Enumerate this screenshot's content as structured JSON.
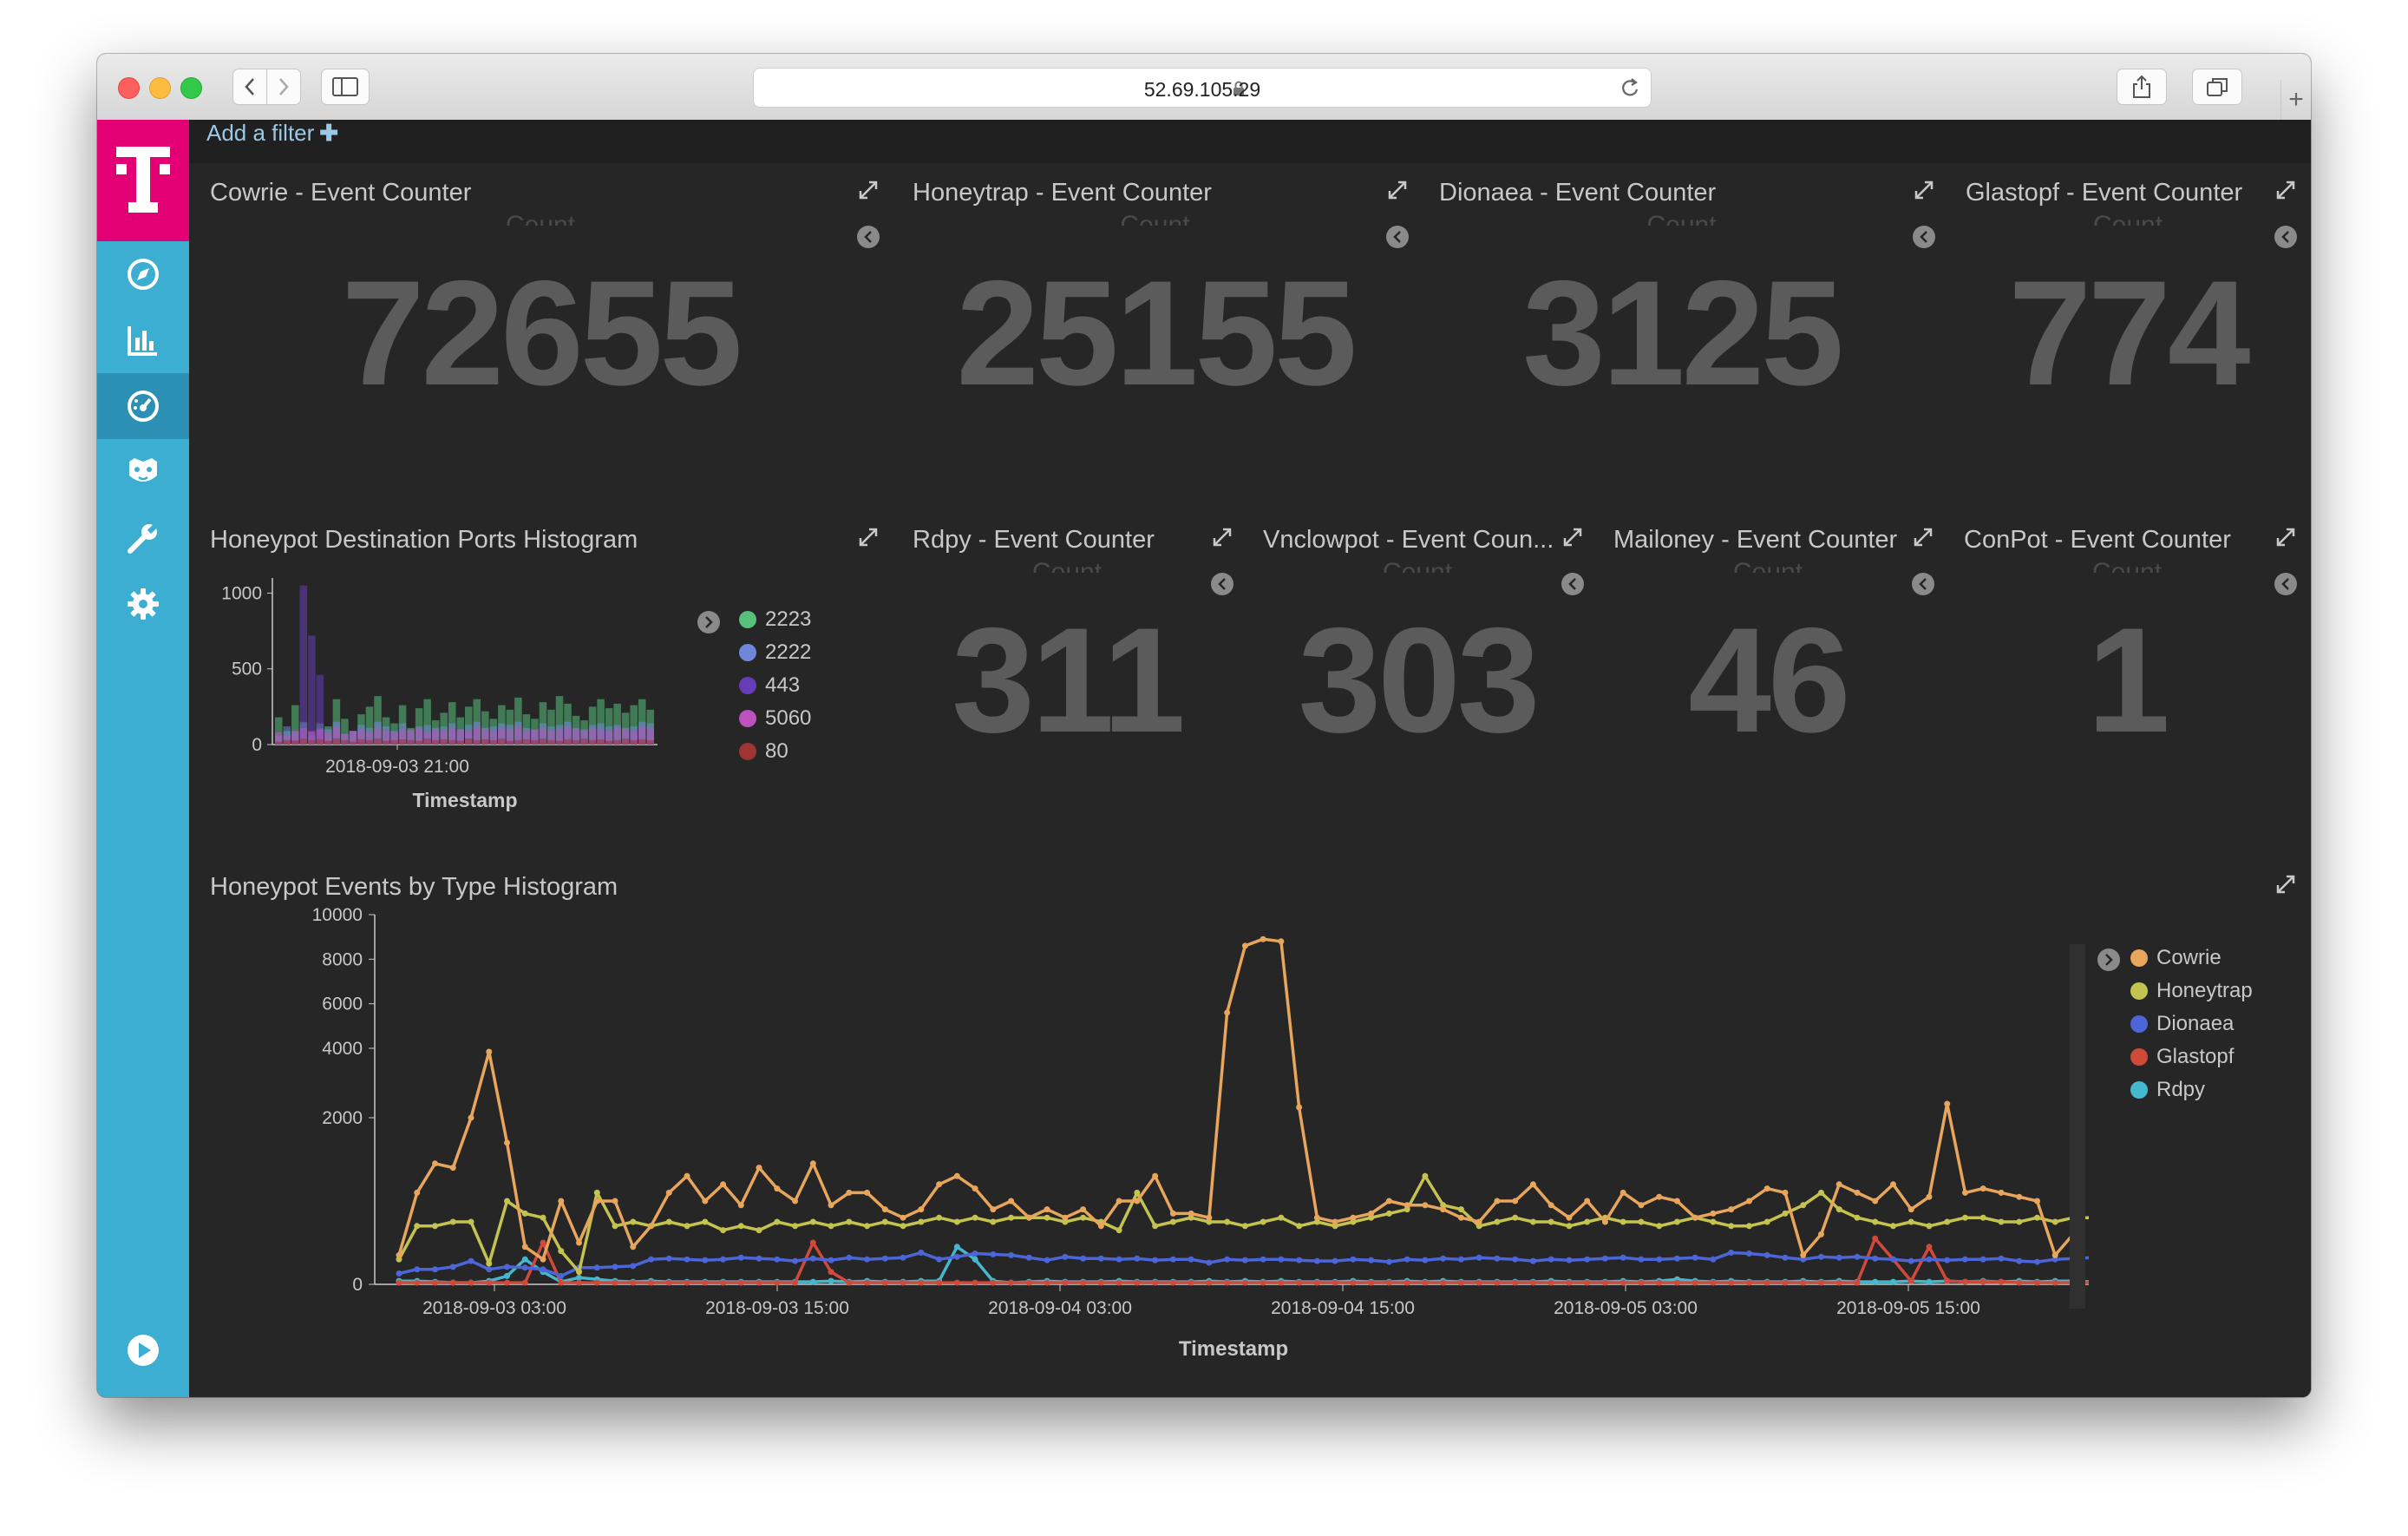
{
  "browser": {
    "url": "52.69.105.29",
    "colors": {
      "close": "#fc605c",
      "minimize": "#fdbc40",
      "zoom": "#34c84a"
    }
  },
  "kibana": {
    "brand_color": "#e20074",
    "sidebar_color": "#3caed2",
    "filter_label": "Add a filter",
    "filter_plus": "✚"
  },
  "counters": [
    {
      "title": "Cowrie - Event Counter",
      "label": "Count",
      "value": "72655"
    },
    {
      "title": "Honeytrap - Event Counter",
      "label": "Count",
      "value": "25155"
    },
    {
      "title": "Dionaea - Event Counter",
      "label": "Count",
      "value": "3125"
    },
    {
      "title": "Glastopf - Event Counter",
      "label": "Count",
      "value": "774"
    },
    {
      "title": "Rdpy - Event Counter",
      "label": "Count",
      "value": "311"
    },
    {
      "title": "Vnclowpot - Event Coun...",
      "label": "Count",
      "value": "303"
    },
    {
      "title": "Mailoney - Event Counter",
      "label": "Count",
      "value": "46"
    },
    {
      "title": "ConPot - Event Counter",
      "label": "Count",
      "value": "1"
    }
  ],
  "ports_histogram": {
    "title": "Honeypot Destination Ports Histogram",
    "chart_data": {
      "type": "bar",
      "xlabel": "Timestamp",
      "x_tick_labels": [
        "2018-09-03 21:00"
      ],
      "y_ticks": [
        0,
        500,
        1000
      ],
      "ylim": [
        0,
        1100
      ],
      "series": [
        {
          "name": "2223",
          "color": "#57c17b",
          "values": [
            180,
            90,
            260,
            150,
            60,
            140,
            120,
            300,
            170,
            90,
            200,
            250,
            320,
            180,
            140,
            260,
            110,
            240,
            300,
            160,
            210,
            280,
            180,
            250,
            300,
            220,
            170,
            260,
            230,
            310,
            200,
            170,
            280,
            230,
            320,
            270,
            190,
            160,
            250,
            300,
            240,
            270,
            210,
            260,
            300,
            230
          ]
        },
        {
          "name": "2222",
          "color": "#6f87d8",
          "values": [
            60,
            120,
            90,
            140,
            80,
            110,
            100,
            150,
            70,
            90,
            130,
            110,
            150,
            120,
            90,
            140,
            100,
            120,
            130,
            110,
            120,
            140,
            100,
            130,
            150,
            110,
            120,
            140,
            130,
            150,
            110,
            100,
            140,
            120,
            130,
            150,
            110,
            100,
            130,
            140,
            120,
            130,
            110,
            120,
            150,
            140
          ]
        },
        {
          "name": "443",
          "color": "#663db8",
          "values": [
            10,
            20,
            30,
            1050,
            720,
            460,
            20,
            10,
            15,
            10,
            20,
            15,
            10,
            20,
            15,
            10,
            20,
            15,
            10,
            20,
            15,
            10,
            20,
            15,
            10,
            20,
            15,
            10,
            20,
            15,
            10,
            20,
            15,
            10,
            20,
            15,
            10,
            20,
            15,
            10,
            20,
            15,
            10,
            20,
            15,
            10
          ]
        },
        {
          "name": "5060",
          "color": "#bc52bc",
          "values": [
            80,
            60,
            90,
            110,
            90,
            100,
            80,
            120,
            70,
            90,
            100,
            80,
            110,
            90,
            80,
            100,
            90,
            110,
            80,
            100,
            90,
            110,
            100,
            90,
            120,
            100,
            90,
            110,
            100,
            120,
            90,
            100,
            110,
            90,
            100,
            120,
            100,
            90,
            110,
            100,
            90,
            110,
            100,
            90,
            120,
            110
          ]
        },
        {
          "name": "80",
          "color": "#9e3533",
          "values": [
            20,
            30,
            25,
            40,
            30,
            35,
            25,
            40,
            30,
            20,
            35,
            30,
            40,
            25,
            30,
            35,
            30,
            25,
            40,
            30,
            35,
            30,
            25,
            40,
            30,
            35,
            30,
            40,
            25,
            30,
            35,
            30,
            40,
            30,
            25,
            35,
            30,
            40,
            30,
            35,
            25,
            30,
            40,
            30,
            35,
            30
          ]
        }
      ]
    }
  },
  "events_histogram": {
    "title": "Honeypot Events by Type Histogram",
    "chart_data": {
      "type": "line",
      "xlabel": "Timestamp",
      "x_tick_labels": [
        "2018-09-03 03:00",
        "2018-09-03 15:00",
        "2018-09-04 03:00",
        "2018-09-04 15:00",
        "2018-09-05 03:00",
        "2018-09-05 15:00"
      ],
      "y_ticks": [
        0,
        2000,
        4000,
        6000,
        8000,
        10000
      ],
      "ylim": [
        0,
        10000
      ],
      "x_start": "2018-09-02 22:00",
      "x_step_hours": 1,
      "series": [
        {
          "name": "Cowrie",
          "color": "#e7a65b",
          "values": [
            350,
            1100,
            1450,
            1400,
            2000,
            3900,
            1700,
            450,
            300,
            1000,
            500,
            1000,
            1000,
            450,
            700,
            1100,
            1300,
            1000,
            1200,
            950,
            1400,
            1150,
            1000,
            1450,
            950,
            1100,
            1100,
            900,
            800,
            900,
            1200,
            1300,
            1150,
            900,
            1000,
            800,
            900,
            800,
            900,
            700,
            1000,
            1000,
            1300,
            850,
            850,
            800,
            5600,
            8600,
            8900,
            8800,
            2300,
            800,
            750,
            800,
            850,
            1000,
            950,
            950,
            900,
            800,
            750,
            1000,
            1000,
            1200,
            950,
            800,
            1000,
            750,
            1100,
            950,
            1050,
            1000,
            800,
            850,
            900,
            1000,
            1150,
            1100,
            350,
            600,
            1200,
            1100,
            1000,
            1200,
            900,
            1050,
            2400,
            1100,
            1150,
            1100,
            1050,
            1000,
            350,
            600
          ]
        },
        {
          "name": "Honeytrap",
          "color": "#c5c34f",
          "values": [
            300,
            700,
            700,
            750,
            750,
            250,
            1000,
            850,
            800,
            400,
            150,
            1100,
            700,
            750,
            700,
            750,
            700,
            750,
            650,
            700,
            650,
            750,
            700,
            750,
            700,
            750,
            700,
            750,
            700,
            750,
            800,
            750,
            800,
            750,
            800,
            800,
            800,
            750,
            800,
            750,
            650,
            1100,
            700,
            750,
            800,
            750,
            750,
            700,
            750,
            800,
            700,
            750,
            700,
            750,
            800,
            850,
            900,
            1300,
            950,
            900,
            700,
            750,
            800,
            750,
            750,
            700,
            750,
            800,
            750,
            750,
            700,
            750,
            800,
            750,
            700,
            700,
            750,
            850,
            950,
            1100,
            900,
            800,
            750,
            700,
            750,
            700,
            750,
            800,
            800,
            750,
            750,
            800,
            750,
            800,
            800,
            800,
            10
          ]
        },
        {
          "name": "Dionaea",
          "color": "#4c66d9",
          "values": [
            130,
            180,
            180,
            210,
            280,
            180,
            210,
            200,
            180,
            100,
            200,
            200,
            210,
            220,
            300,
            310,
            300,
            290,
            300,
            320,
            310,
            300,
            280,
            310,
            290,
            320,
            300,
            310,
            320,
            380,
            300,
            330,
            370,
            360,
            350,
            320,
            290,
            330,
            310,
            310,
            300,
            310,
            290,
            300,
            300,
            260,
            300,
            290,
            300,
            300,
            290,
            280,
            280,
            300,
            290,
            270,
            300,
            290,
            310,
            300,
            320,
            310,
            300,
            280,
            300,
            290,
            300,
            310,
            320,
            300,
            300,
            310,
            320,
            300,
            380,
            370,
            350,
            320,
            300,
            330,
            320,
            330,
            310,
            300,
            280,
            300,
            290,
            300,
            300,
            310,
            280,
            270,
            300,
            310,
            320,
            300
          ]
        },
        {
          "name": "Glastopf",
          "color": "#d04a3c",
          "values": [
            20,
            20,
            20,
            20,
            20,
            20,
            20,
            20,
            500,
            20,
            20,
            20,
            20,
            20,
            20,
            20,
            20,
            20,
            20,
            20,
            20,
            20,
            20,
            500,
            150,
            20,
            20,
            20,
            20,
            20,
            20,
            20,
            20,
            20,
            20,
            20,
            20,
            20,
            20,
            20,
            20,
            20,
            20,
            20,
            20,
            20,
            20,
            20,
            20,
            20,
            20,
            20,
            20,
            20,
            20,
            20,
            20,
            20,
            20,
            20,
            20,
            20,
            20,
            20,
            20,
            20,
            20,
            20,
            20,
            20,
            20,
            20,
            20,
            20,
            20,
            20,
            20,
            20,
            20,
            20,
            20,
            20,
            550,
            300,
            40,
            450,
            40,
            30,
            30,
            30,
            20,
            20,
            20,
            20,
            20,
            20
          ]
        },
        {
          "name": "Rdpy",
          "color": "#45b8cd",
          "values": [
            40,
            40,
            30,
            20,
            20,
            40,
            100,
            300,
            150,
            30,
            80,
            60,
            40,
            30,
            40,
            30,
            30,
            30,
            30,
            30,
            30,
            30,
            30,
            30,
            40,
            30,
            40,
            30,
            30,
            40,
            40,
            450,
            300,
            40,
            20,
            30,
            40,
            30,
            30,
            30,
            40,
            30,
            30,
            30,
            30,
            40,
            30,
            40,
            30,
            40,
            30,
            30,
            30,
            40,
            30,
            30,
            40,
            30,
            40,
            30,
            30,
            30,
            30,
            30,
            40,
            30,
            30,
            30,
            40,
            30,
            40,
            60,
            40,
            30,
            40,
            30,
            30,
            30,
            40,
            30,
            40,
            30,
            30,
            30,
            40,
            30,
            40,
            30,
            40,
            30,
            40,
            30,
            40,
            40,
            30,
            40
          ]
        }
      ]
    }
  }
}
